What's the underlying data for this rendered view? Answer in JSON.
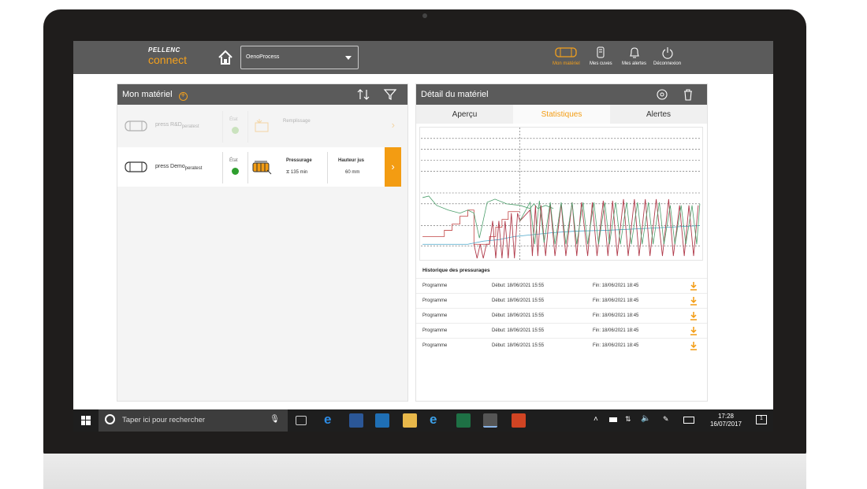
{
  "app": {
    "brand": "PELLENC",
    "product": "connect",
    "device_selected": "OenoProcess"
  },
  "nav": [
    {
      "label": "Mon matériel",
      "icon": "press-icon",
      "active": true
    },
    {
      "label": "Mes cuves",
      "icon": "tank-icon",
      "active": false
    },
    {
      "label": "Mes alertes",
      "icon": "bell-icon",
      "active": false
    },
    {
      "label": "Déconnexion",
      "icon": "power-icon",
      "active": false
    }
  ],
  "left_panel": {
    "title": "Mon matériel",
    "rows": [
      {
        "name": "press R&D",
        "sub": "peratest",
        "etat_label": "État",
        "status_color": "#7dc35b",
        "step": "Remplissage",
        "faded": true
      },
      {
        "name": "press Demo",
        "sub": "peratest",
        "etat_label": "État",
        "status_color": "#2e9e2e",
        "step": "Pressurage",
        "duration": "135 min",
        "metric_label": "Hauteur jus",
        "metric_value": "60 mm",
        "faded": false
      }
    ]
  },
  "right_panel": {
    "title": "Détail du matériel",
    "tabs": [
      "Aperçu",
      "Statistiques",
      "Alertes"
    ],
    "active_tab": 1,
    "history_title": "Historique des pressurages",
    "history": [
      {
        "program": "Programme",
        "start": "Début: 18/06/2021 15:55",
        "end": "Fin: 18/06/2021 18:45"
      },
      {
        "program": "Programme",
        "start": "Début: 18/06/2021 15:55",
        "end": "Fin: 18/06/2021 18:45"
      },
      {
        "program": "Programme",
        "start": "Début: 18/06/2021 15:55",
        "end": "Fin: 18/06/2021 18:45"
      },
      {
        "program": "Programme",
        "start": "Début: 18/06/2021 15:55",
        "end": "Fin: 18/06/2021 18:45"
      },
      {
        "program": "Programme",
        "start": "Début: 18/06/2021 15:55",
        "end": "Fin: 18/06/2021 18:45"
      }
    ]
  },
  "taskbar": {
    "search_placeholder": "Taper ici pour rechercher",
    "time": "17:28",
    "date": "16/07/2017",
    "notification_count": "1"
  },
  "colors": {
    "accent": "#f39c12",
    "header": "#5b5b5b"
  }
}
